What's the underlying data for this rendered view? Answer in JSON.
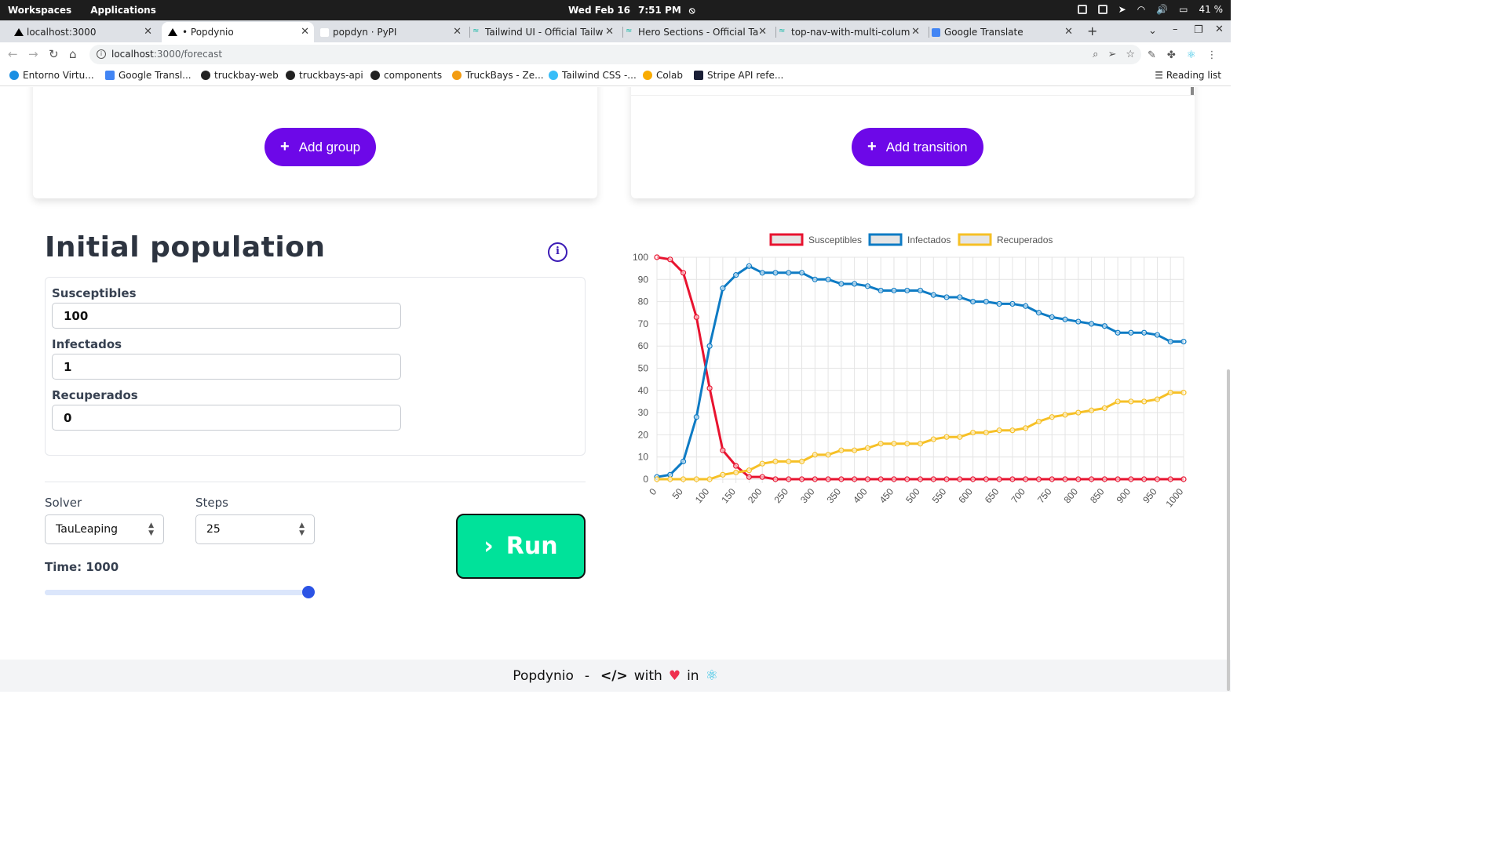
{
  "os": {
    "workspaces": "Workspaces",
    "applications": "Applications",
    "date": "Wed Feb 16",
    "time": "7:51 PM",
    "battery": "41 %"
  },
  "tabs": [
    {
      "title": "localhost:3000"
    },
    {
      "title": "Popdynio"
    },
    {
      "title": "popdyn · PyPI"
    },
    {
      "title": "Tailwind UI - Official Tailw"
    },
    {
      "title": "Hero Sections - Official Ta"
    },
    {
      "title": "top-nav-with-multi-colum"
    },
    {
      "title": "Google Translate"
    }
  ],
  "address": {
    "host": "localhost",
    "path": ":3000/forecast"
  },
  "bookmarks": [
    {
      "label": "Entorno Virtu...",
      "color": "#1a8fe3"
    },
    {
      "label": "Google Transl...",
      "color": "#4285f4"
    },
    {
      "label": "truckbay-web",
      "color": "#222222"
    },
    {
      "label": "truckbays-api",
      "color": "#222222"
    },
    {
      "label": "components",
      "color": "#222222"
    },
    {
      "label": "TruckBays - Ze...",
      "color": "#f39c12"
    },
    {
      "label": "Tailwind CSS -...",
      "color": "#38bdf8"
    },
    {
      "label": "Colab",
      "color": "#f9ab00"
    },
    {
      "label": "Stripe API refe...",
      "color": "#1a1f36"
    }
  ],
  "reading_list": "Reading list",
  "groups": {
    "add_label": "Add group"
  },
  "transitions": {
    "add_label": "Add transition"
  },
  "population": {
    "title": "Initial population",
    "fields": [
      {
        "label": "Susceptibles",
        "value": "100"
      },
      {
        "label": "Infectados",
        "value": "1"
      },
      {
        "label": "Recuperados",
        "value": "0"
      }
    ]
  },
  "controls": {
    "solver_label": "Solver",
    "solver_value": "TauLeaping",
    "steps_label": "Steps",
    "steps_value": "25",
    "time_label": "Time: 1000",
    "time_fraction": 1.0,
    "run_label": "Run"
  },
  "footer": {
    "brand": "Popdynio",
    "dash": "-",
    "with": "with",
    "in": "in"
  },
  "colors": {
    "accent": "#6d08e8",
    "run": "#00e29a",
    "susceptibles": "#e8132f",
    "infectados": "#0e7bc4",
    "recuperados": "#f6c026"
  },
  "chart_data": {
    "type": "line",
    "legend": "top",
    "grid": true,
    "x": [
      0,
      25,
      50,
      75,
      100,
      125,
      150,
      175,
      200,
      225,
      250,
      275,
      300,
      325,
      350,
      375,
      400,
      425,
      450,
      475,
      500,
      525,
      550,
      575,
      600,
      625,
      650,
      675,
      700,
      725,
      750,
      775,
      800,
      825,
      850,
      875,
      900,
      925,
      950,
      975,
      1000
    ],
    "x_ticks": [
      0,
      50,
      100,
      150,
      200,
      250,
      300,
      350,
      400,
      450,
      500,
      550,
      600,
      650,
      700,
      750,
      800,
      850,
      900,
      950,
      1000
    ],
    "ylim": [
      0,
      100
    ],
    "y_ticks": [
      0,
      10,
      20,
      30,
      40,
      50,
      60,
      70,
      80,
      90,
      100
    ],
    "series": [
      {
        "name": "Susceptibles",
        "color": "#e8132f",
        "values": [
          100,
          99,
          93,
          73,
          41,
          13,
          6,
          1,
          1,
          0,
          0,
          0,
          0,
          0,
          0,
          0,
          0,
          0,
          0,
          0,
          0,
          0,
          0,
          0,
          0,
          0,
          0,
          0,
          0,
          0,
          0,
          0,
          0,
          0,
          0,
          0,
          0,
          0,
          0,
          0,
          0
        ]
      },
      {
        "name": "Infectados",
        "color": "#0e7bc4",
        "values": [
          1,
          2,
          8,
          28,
          60,
          86,
          92,
          96,
          93,
          93,
          93,
          93,
          90,
          90,
          88,
          88,
          87,
          85,
          85,
          85,
          85,
          83,
          82,
          82,
          80,
          80,
          79,
          79,
          78,
          75,
          73,
          72,
          71,
          70,
          69,
          66,
          66,
          66,
          65,
          62,
          62
        ]
      },
      {
        "name": "Recuperados",
        "color": "#f6c026",
        "values": [
          0,
          0,
          0,
          0,
          0,
          2,
          3,
          4,
          7,
          8,
          8,
          8,
          11,
          11,
          13,
          13,
          14,
          16,
          16,
          16,
          16,
          18,
          19,
          19,
          21,
          21,
          22,
          22,
          23,
          26,
          28,
          29,
          30,
          31,
          32,
          35,
          35,
          35,
          36,
          39,
          39
        ]
      }
    ]
  }
}
